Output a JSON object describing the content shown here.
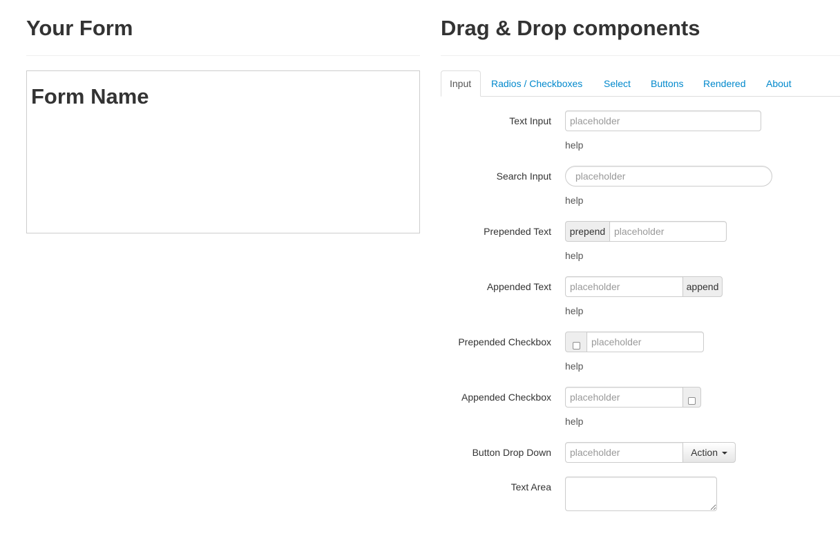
{
  "left": {
    "title": "Your Form",
    "form_name": "Form Name"
  },
  "right": {
    "title": "Drag & Drop components"
  },
  "tabs": [
    "Input",
    "Radios / Checkboxes",
    "Select",
    "Buttons",
    "Rendered",
    "About"
  ],
  "active_tab": "Input",
  "components": {
    "text_input": {
      "label": "Text Input",
      "placeholder": "placeholder",
      "help": "help"
    },
    "search_input": {
      "label": "Search Input",
      "placeholder": "placeholder",
      "help": "help"
    },
    "prepended_text": {
      "label": "Prepended Text",
      "prepend": "prepend",
      "placeholder": "placeholder",
      "help": "help"
    },
    "appended_text": {
      "label": "Appended Text",
      "append": "append",
      "placeholder": "placeholder",
      "help": "help"
    },
    "prepended_checkbox": {
      "label": "Prepended Checkbox",
      "placeholder": "placeholder",
      "help": "help"
    },
    "appended_checkbox": {
      "label": "Appended Checkbox",
      "placeholder": "placeholder",
      "help": "help"
    },
    "button_drop_down": {
      "label": "Button Drop Down",
      "placeholder": "placeholder",
      "button": "Action"
    },
    "text_area": {
      "label": "Text Area"
    }
  },
  "colors": {
    "link": "#0088cc",
    "border": "#cccccc",
    "addon_bg": "#eeeeee"
  },
  "icons": [
    "checkbox-icon",
    "caret-down-icon",
    "resize-grip-icon"
  ]
}
